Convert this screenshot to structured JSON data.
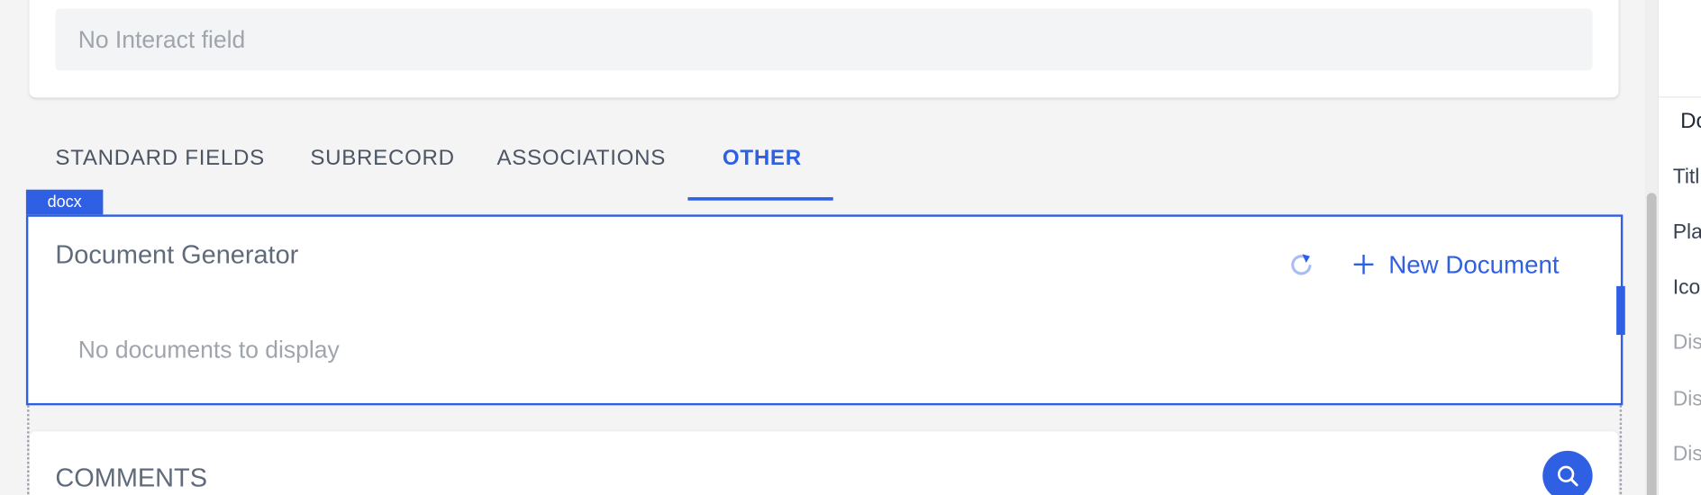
{
  "interact_field": {
    "placeholder": "No Interact field"
  },
  "tabs": [
    {
      "label": "STANDARD FIELDS",
      "active": false
    },
    {
      "label": "SUBRECORD",
      "active": false
    },
    {
      "label": "ASSOCIATIONS",
      "active": false
    },
    {
      "label": "OTHER",
      "active": true
    }
  ],
  "doc_generator": {
    "badge": "docx",
    "title": "Document Generator",
    "new_button_label": "New Document",
    "empty_text": "No documents to display",
    "icons": {
      "refresh": "refresh-icon",
      "add": "plus-icon"
    }
  },
  "comments": {
    "title": "COMMENTS",
    "icon": "search-icon"
  },
  "right_panel": {
    "items": [
      {
        "label": "Do"
      },
      {
        "label": "Titl"
      },
      {
        "label": "Pla"
      },
      {
        "label": "Ico"
      },
      {
        "label": "Dis"
      },
      {
        "label": "Dis"
      },
      {
        "label": "Dis"
      }
    ]
  },
  "colors": {
    "accent": "#2f5fe3",
    "background": "#f4f4f5",
    "muted_text": "#a0a4ab"
  }
}
